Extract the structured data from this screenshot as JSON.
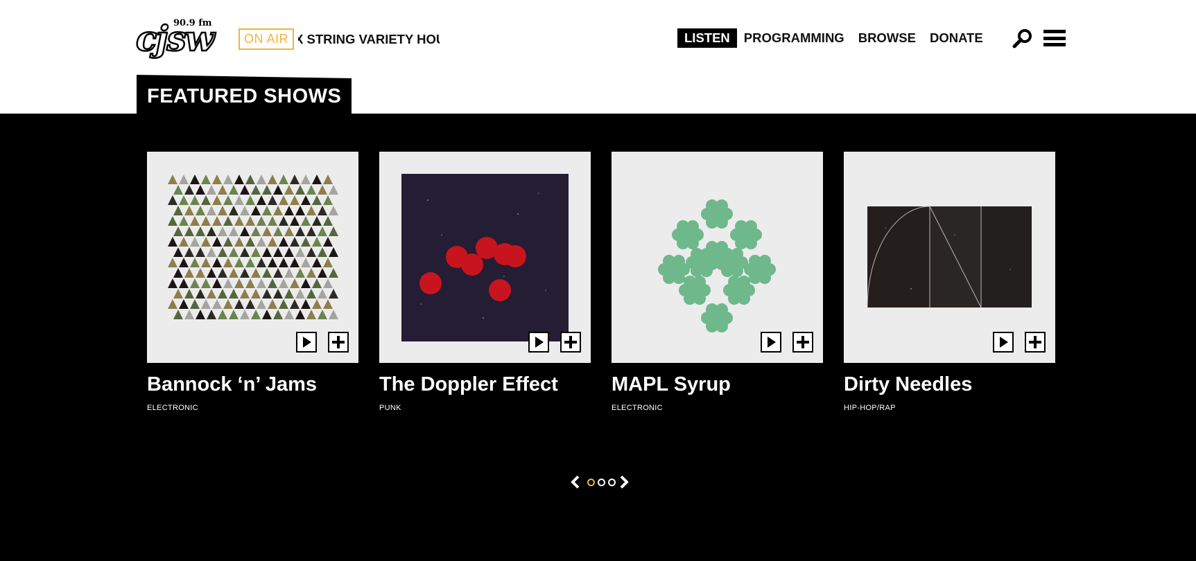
{
  "header": {
    "logo_text": "cjsw",
    "frequency": "90.9 fm",
    "on_air_label": "ON AIR",
    "now_playing": "X STRING VARIETY HOUR",
    "nav": [
      {
        "label": "LISTEN",
        "active": true
      },
      {
        "label": "PROGRAMMING",
        "active": false
      },
      {
        "label": "BROWSE",
        "active": false
      },
      {
        "label": "DONATE",
        "active": false
      }
    ],
    "search_icon": "search-icon",
    "menu_icon": "hamburger-menu-icon"
  },
  "section": {
    "title": "FEATURED SHOWS"
  },
  "shows": [
    {
      "title": "Bannock ‘n’ Jams",
      "genre": "ELECTRONIC",
      "art": "triangles-pattern"
    },
    {
      "title": "The Doppler Effect",
      "genre": "PUNK",
      "art": "red-dots-on-night-sky"
    },
    {
      "title": "MAPL Syrup",
      "genre": "ELECTRONIC",
      "art": "green-koch-snowflake"
    },
    {
      "title": "Dirty Needles",
      "genre": "HIP-HOP/RAP",
      "art": "geometric-lines-on-dark-panel"
    }
  ],
  "pager": {
    "total": 3,
    "current": 1,
    "prev_icon": "chevron-left-icon",
    "next_icon": "chevron-right-icon"
  },
  "colors": {
    "accent": "#f0b43a",
    "background": "#000000",
    "header": "#ffffff"
  }
}
